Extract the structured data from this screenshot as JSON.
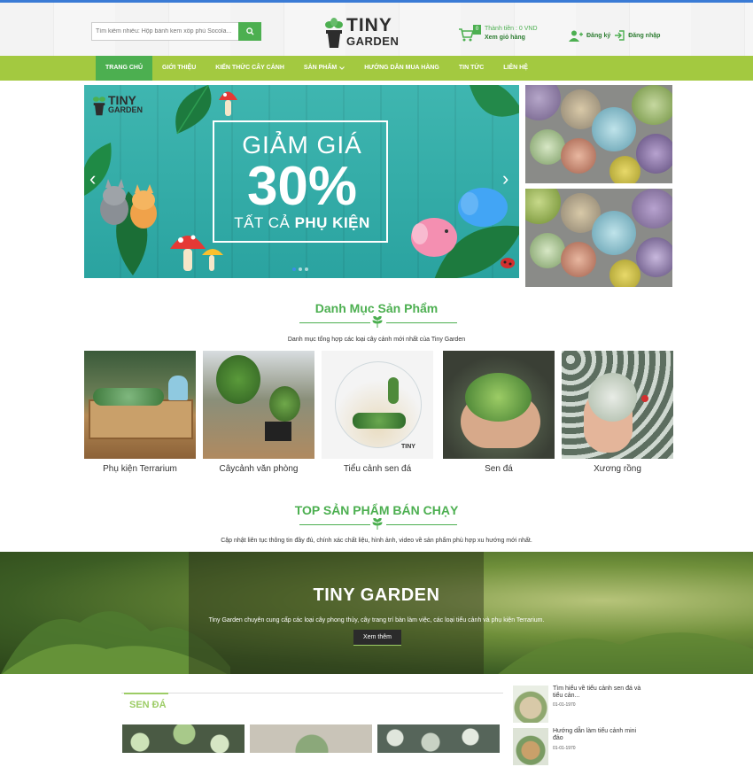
{
  "header": {
    "search_placeholder": "Tìm kiếm nhiều: Hộp bánh kem xốp phủ Socola...",
    "logo_line1": "TINY",
    "logo_line2": "GARDEN",
    "cart_count": "0",
    "cart_total": "Thành tiền : 0 VND",
    "cart_view": "Xem giỏ hàng",
    "register": "Đăng ký",
    "login": "Đăng nhập"
  },
  "nav": {
    "items": [
      "TRANG CHỦ",
      "GIỚI THIỆU",
      "KIẾN THỨC CÂY CẢNH",
      "SẢN PHẨM",
      "HƯỚNG DẪN MUA HÀNG",
      "TIN TỨC",
      "LIÊN HỆ"
    ],
    "active_index": 0
  },
  "banner": {
    "logo_line1": "TINY",
    "logo_line2": "GARDEN",
    "line1": "GIẢM GIÁ",
    "line2": "30%",
    "line3_a": "TẤT CẢ ",
    "line3_b": "PHỤ KIỆN",
    "slide_count": 3,
    "active_slide": 1
  },
  "categories": {
    "title": "Danh Mục Sản Phẩm",
    "subtitle": "Danh mục tổng hợp các loại cây cảnh mới nhất của Tiny Garden",
    "items": [
      "Phụ kiện Terrarium",
      "Câycảnh văn phòng",
      "Tiểu cảnh sen đá",
      "Sen đá",
      "Xương rồng"
    ]
  },
  "top_products": {
    "title": "TOP SẢN PHẨM BÁN CHẠY",
    "subtitle": "Cập nhật liên tục thông tin đầy đủ, chính xác chất liệu, hình ảnh, video về sản phẩm phù hợp xu hướng mới nhất."
  },
  "hero": {
    "title": "TINY GARDEN",
    "description": "Tiny Garden chuyên cung cấp các loại cây phong thủy, cây trang trí bàn làm việc, các loại tiểu cảnh và phụ kiện Terrarium.",
    "button": "Xem thêm"
  },
  "product_tab": {
    "label": "SEN ĐÁ"
  },
  "news": [
    {
      "title": "Tìm hiểu về tiểu cảnh sen đá và tiểu cản...",
      "date": "01-01-1970"
    },
    {
      "title": "Hướng dẫn làm tiểu cảnh mini đảo",
      "date": "01-01-1970"
    }
  ],
  "colors": {
    "accent_green": "#4caf50",
    "nav_green": "#a3c940",
    "banner_teal": "#2aa3a0"
  }
}
